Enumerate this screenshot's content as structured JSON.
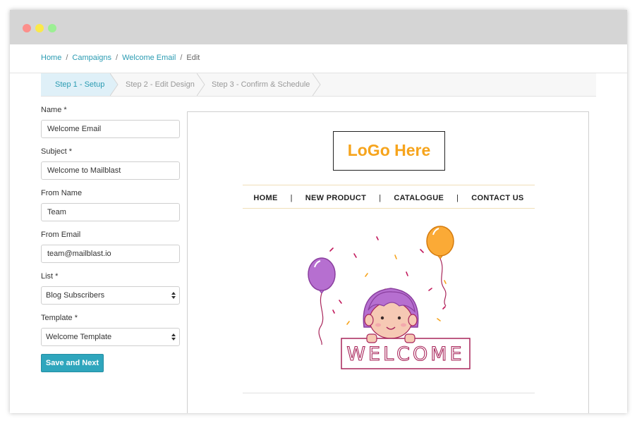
{
  "breadcrumb": {
    "home": "Home",
    "campaigns": "Campaigns",
    "welcome_email": "Welcome Email",
    "current": "Edit",
    "separator": "/"
  },
  "steps": [
    {
      "label": "Step 1 - Setup",
      "active": true
    },
    {
      "label": "Step 2 - Edit Design",
      "active": false
    },
    {
      "label": "Step 3 - Confirm & Schedule",
      "active": false
    }
  ],
  "form": {
    "name_label": "Name *",
    "name_value": "Welcome Email",
    "subject_label": "Subject *",
    "subject_value": "Welcome to Mailblast",
    "from_name_label": "From Name",
    "from_name_value": "Team",
    "from_email_label": "From Email",
    "from_email_value": "team@mailblast.io",
    "list_label": "List *",
    "list_value": "Blog Subscribers",
    "template_label": "Template *",
    "template_value": "Welcome Template",
    "save_label": "Save and Next"
  },
  "preview": {
    "logo_text": "LoGo Here",
    "nav": {
      "home": "HOME",
      "new_product": "NEW PRODUCT",
      "catalogue": "CATALOGUE",
      "contact": "CONTACT US",
      "divider": "|"
    },
    "banner_text": "WELCOME"
  },
  "colors": {
    "accent": "#2fa6bd",
    "link": "#2a9bb2",
    "logo": "#f6a41c",
    "balloon_purple": "#b66fd0",
    "balloon_orange": "#fbaa36",
    "banner_stroke": "#a8255a"
  }
}
